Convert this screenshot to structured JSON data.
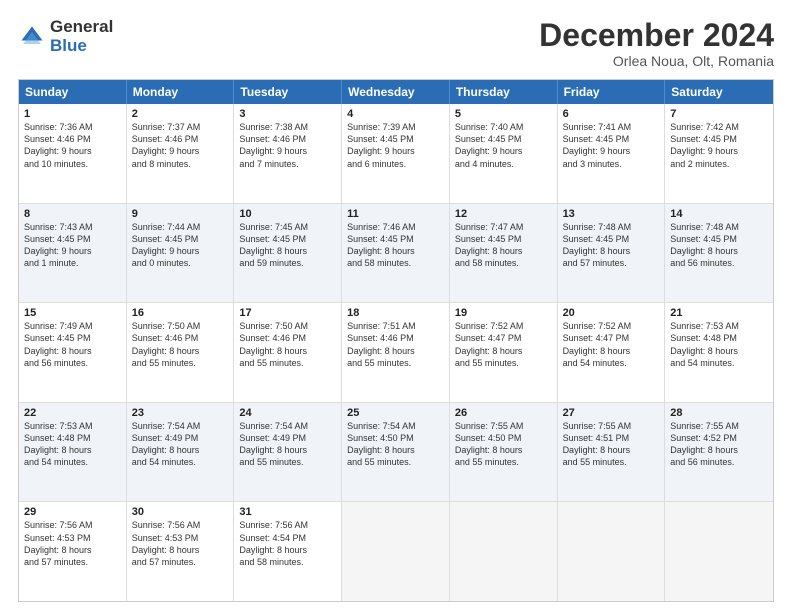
{
  "logo": {
    "general": "General",
    "blue": "Blue"
  },
  "title": {
    "month": "December 2024",
    "location": "Orlea Noua, Olt, Romania"
  },
  "days": [
    "Sunday",
    "Monday",
    "Tuesday",
    "Wednesday",
    "Thursday",
    "Friday",
    "Saturday"
  ],
  "rows": [
    [
      {
        "day": "1",
        "lines": [
          "Sunrise: 7:36 AM",
          "Sunset: 4:46 PM",
          "Daylight: 9 hours",
          "and 10 minutes."
        ]
      },
      {
        "day": "2",
        "lines": [
          "Sunrise: 7:37 AM",
          "Sunset: 4:46 PM",
          "Daylight: 9 hours",
          "and 8 minutes."
        ]
      },
      {
        "day": "3",
        "lines": [
          "Sunrise: 7:38 AM",
          "Sunset: 4:46 PM",
          "Daylight: 9 hours",
          "and 7 minutes."
        ]
      },
      {
        "day": "4",
        "lines": [
          "Sunrise: 7:39 AM",
          "Sunset: 4:45 PM",
          "Daylight: 9 hours",
          "and 6 minutes."
        ]
      },
      {
        "day": "5",
        "lines": [
          "Sunrise: 7:40 AM",
          "Sunset: 4:45 PM",
          "Daylight: 9 hours",
          "and 4 minutes."
        ]
      },
      {
        "day": "6",
        "lines": [
          "Sunrise: 7:41 AM",
          "Sunset: 4:45 PM",
          "Daylight: 9 hours",
          "and 3 minutes."
        ]
      },
      {
        "day": "7",
        "lines": [
          "Sunrise: 7:42 AM",
          "Sunset: 4:45 PM",
          "Daylight: 9 hours",
          "and 2 minutes."
        ]
      }
    ],
    [
      {
        "day": "8",
        "lines": [
          "Sunrise: 7:43 AM",
          "Sunset: 4:45 PM",
          "Daylight: 9 hours",
          "and 1 minute."
        ]
      },
      {
        "day": "9",
        "lines": [
          "Sunrise: 7:44 AM",
          "Sunset: 4:45 PM",
          "Daylight: 9 hours",
          "and 0 minutes."
        ]
      },
      {
        "day": "10",
        "lines": [
          "Sunrise: 7:45 AM",
          "Sunset: 4:45 PM",
          "Daylight: 8 hours",
          "and 59 minutes."
        ]
      },
      {
        "day": "11",
        "lines": [
          "Sunrise: 7:46 AM",
          "Sunset: 4:45 PM",
          "Daylight: 8 hours",
          "and 58 minutes."
        ]
      },
      {
        "day": "12",
        "lines": [
          "Sunrise: 7:47 AM",
          "Sunset: 4:45 PM",
          "Daylight: 8 hours",
          "and 58 minutes."
        ]
      },
      {
        "day": "13",
        "lines": [
          "Sunrise: 7:48 AM",
          "Sunset: 4:45 PM",
          "Daylight: 8 hours",
          "and 57 minutes."
        ]
      },
      {
        "day": "14",
        "lines": [
          "Sunrise: 7:48 AM",
          "Sunset: 4:45 PM",
          "Daylight: 8 hours",
          "and 56 minutes."
        ]
      }
    ],
    [
      {
        "day": "15",
        "lines": [
          "Sunrise: 7:49 AM",
          "Sunset: 4:45 PM",
          "Daylight: 8 hours",
          "and 56 minutes."
        ]
      },
      {
        "day": "16",
        "lines": [
          "Sunrise: 7:50 AM",
          "Sunset: 4:46 PM",
          "Daylight: 8 hours",
          "and 55 minutes."
        ]
      },
      {
        "day": "17",
        "lines": [
          "Sunrise: 7:50 AM",
          "Sunset: 4:46 PM",
          "Daylight: 8 hours",
          "and 55 minutes."
        ]
      },
      {
        "day": "18",
        "lines": [
          "Sunrise: 7:51 AM",
          "Sunset: 4:46 PM",
          "Daylight: 8 hours",
          "and 55 minutes."
        ]
      },
      {
        "day": "19",
        "lines": [
          "Sunrise: 7:52 AM",
          "Sunset: 4:47 PM",
          "Daylight: 8 hours",
          "and 55 minutes."
        ]
      },
      {
        "day": "20",
        "lines": [
          "Sunrise: 7:52 AM",
          "Sunset: 4:47 PM",
          "Daylight: 8 hours",
          "and 54 minutes."
        ]
      },
      {
        "day": "21",
        "lines": [
          "Sunrise: 7:53 AM",
          "Sunset: 4:48 PM",
          "Daylight: 8 hours",
          "and 54 minutes."
        ]
      }
    ],
    [
      {
        "day": "22",
        "lines": [
          "Sunrise: 7:53 AM",
          "Sunset: 4:48 PM",
          "Daylight: 8 hours",
          "and 54 minutes."
        ]
      },
      {
        "day": "23",
        "lines": [
          "Sunrise: 7:54 AM",
          "Sunset: 4:49 PM",
          "Daylight: 8 hours",
          "and 54 minutes."
        ]
      },
      {
        "day": "24",
        "lines": [
          "Sunrise: 7:54 AM",
          "Sunset: 4:49 PM",
          "Daylight: 8 hours",
          "and 55 minutes."
        ]
      },
      {
        "day": "25",
        "lines": [
          "Sunrise: 7:54 AM",
          "Sunset: 4:50 PM",
          "Daylight: 8 hours",
          "and 55 minutes."
        ]
      },
      {
        "day": "26",
        "lines": [
          "Sunrise: 7:55 AM",
          "Sunset: 4:50 PM",
          "Daylight: 8 hours",
          "and 55 minutes."
        ]
      },
      {
        "day": "27",
        "lines": [
          "Sunrise: 7:55 AM",
          "Sunset: 4:51 PM",
          "Daylight: 8 hours",
          "and 55 minutes."
        ]
      },
      {
        "day": "28",
        "lines": [
          "Sunrise: 7:55 AM",
          "Sunset: 4:52 PM",
          "Daylight: 8 hours",
          "and 56 minutes."
        ]
      }
    ],
    [
      {
        "day": "29",
        "lines": [
          "Sunrise: 7:56 AM",
          "Sunset: 4:53 PM",
          "Daylight: 8 hours",
          "and 57 minutes."
        ]
      },
      {
        "day": "30",
        "lines": [
          "Sunrise: 7:56 AM",
          "Sunset: 4:53 PM",
          "Daylight: 8 hours",
          "and 57 minutes."
        ]
      },
      {
        "day": "31",
        "lines": [
          "Sunrise: 7:56 AM",
          "Sunset: 4:54 PM",
          "Daylight: 8 hours",
          "and 58 minutes."
        ]
      },
      null,
      null,
      null,
      null
    ]
  ]
}
